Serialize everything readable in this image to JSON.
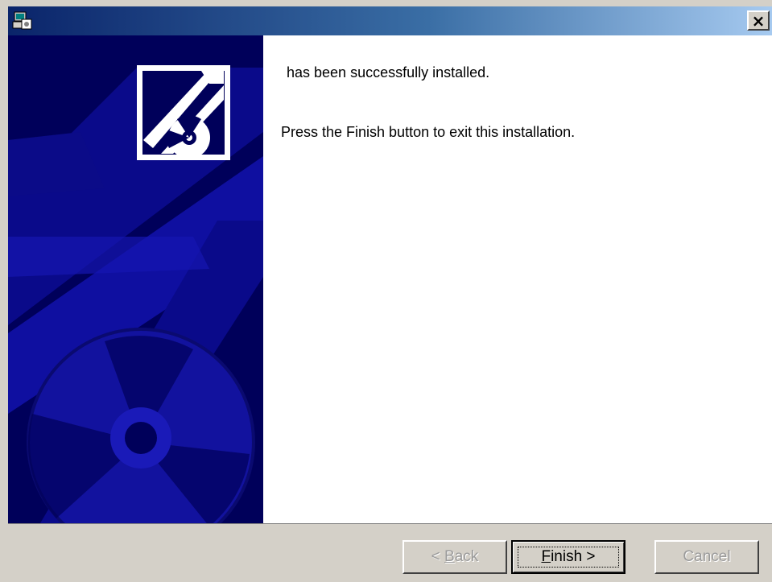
{
  "window": {
    "icon": "installer-icon",
    "close_label": "×"
  },
  "sidebar": {
    "logo": "install-cd-logo",
    "background_color": "#00005a"
  },
  "content": {
    "line1": "has been successfully installed.",
    "line2": "Press the Finish button to exit this installation."
  },
  "buttons": {
    "back": {
      "prefix": "< ",
      "accel": "B",
      "rest": "ack",
      "disabled": true
    },
    "finish": {
      "accel": "F",
      "rest": "inish >",
      "disabled": false
    },
    "cancel": {
      "label": "Cancel",
      "disabled": true
    }
  },
  "colors": {
    "title_gradient_start": "#0a246a",
    "title_gradient_end": "#a6caf0",
    "dialog_face": "#d4d0c8"
  }
}
